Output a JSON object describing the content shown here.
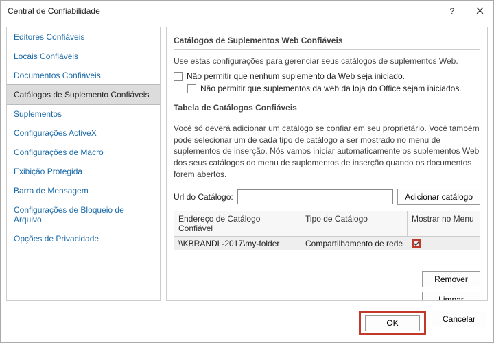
{
  "title": "Central de Confiabilidade",
  "sidebar": {
    "items": [
      {
        "label": "Editores Confiáveis"
      },
      {
        "label": "Locais Confiáveis"
      },
      {
        "label": "Documentos Confiáveis"
      },
      {
        "label": "Catálogos de Suplemento Confiáveis",
        "selected": true
      },
      {
        "label": "Suplementos"
      },
      {
        "label": "Configurações ActiveX"
      },
      {
        "label": "Configurações de Macro"
      },
      {
        "label": "Exibição Protegida"
      },
      {
        "label": "Barra de Mensagem"
      },
      {
        "label": "Configurações de Bloqueio de Arquivo"
      },
      {
        "label": "Opções de Privacidade"
      }
    ]
  },
  "group1": {
    "heading": "Catálogos de Suplementos Web Confiáveis",
    "intro": "Use estas configurações para gerenciar seus catálogos de suplementos Web.",
    "cb1": "Não permitir que nenhum suplemento da Web seja iniciado.",
    "cb2": "Não permitir que suplementos da web da loja do Office sejam iniciados."
  },
  "group2": {
    "heading": "Tabela de Catálogos Confiáveis",
    "note": "Você só deverá adicionar um catálogo se confiar em seu proprietário. Você também pode selecionar um de cada tipo de catálogo a ser mostrado no menu de suplementos de inserção. Nós vamos iniciar automaticamente os suplementos Web dos seus catálogos do menu de suplementos de inserção quando os documentos forem abertos.",
    "url_label": "Url do Catálogo:",
    "url_value": "",
    "add_btn": "Adicionar catálogo",
    "cols": {
      "c1": "Endereço de Catálogo Confiável",
      "c2": "Tipo de Catálogo",
      "c3": "Mostrar no Menu"
    },
    "rows": [
      {
        "addr": "\\\\KBRANDL-2017\\my-folder",
        "type": "Compartilhamento de rede",
        "show": true
      }
    ],
    "remove_btn": "Remover",
    "clear_btn": "Limpar"
  },
  "footer": {
    "ok": "OK",
    "cancel": "Cancelar"
  }
}
